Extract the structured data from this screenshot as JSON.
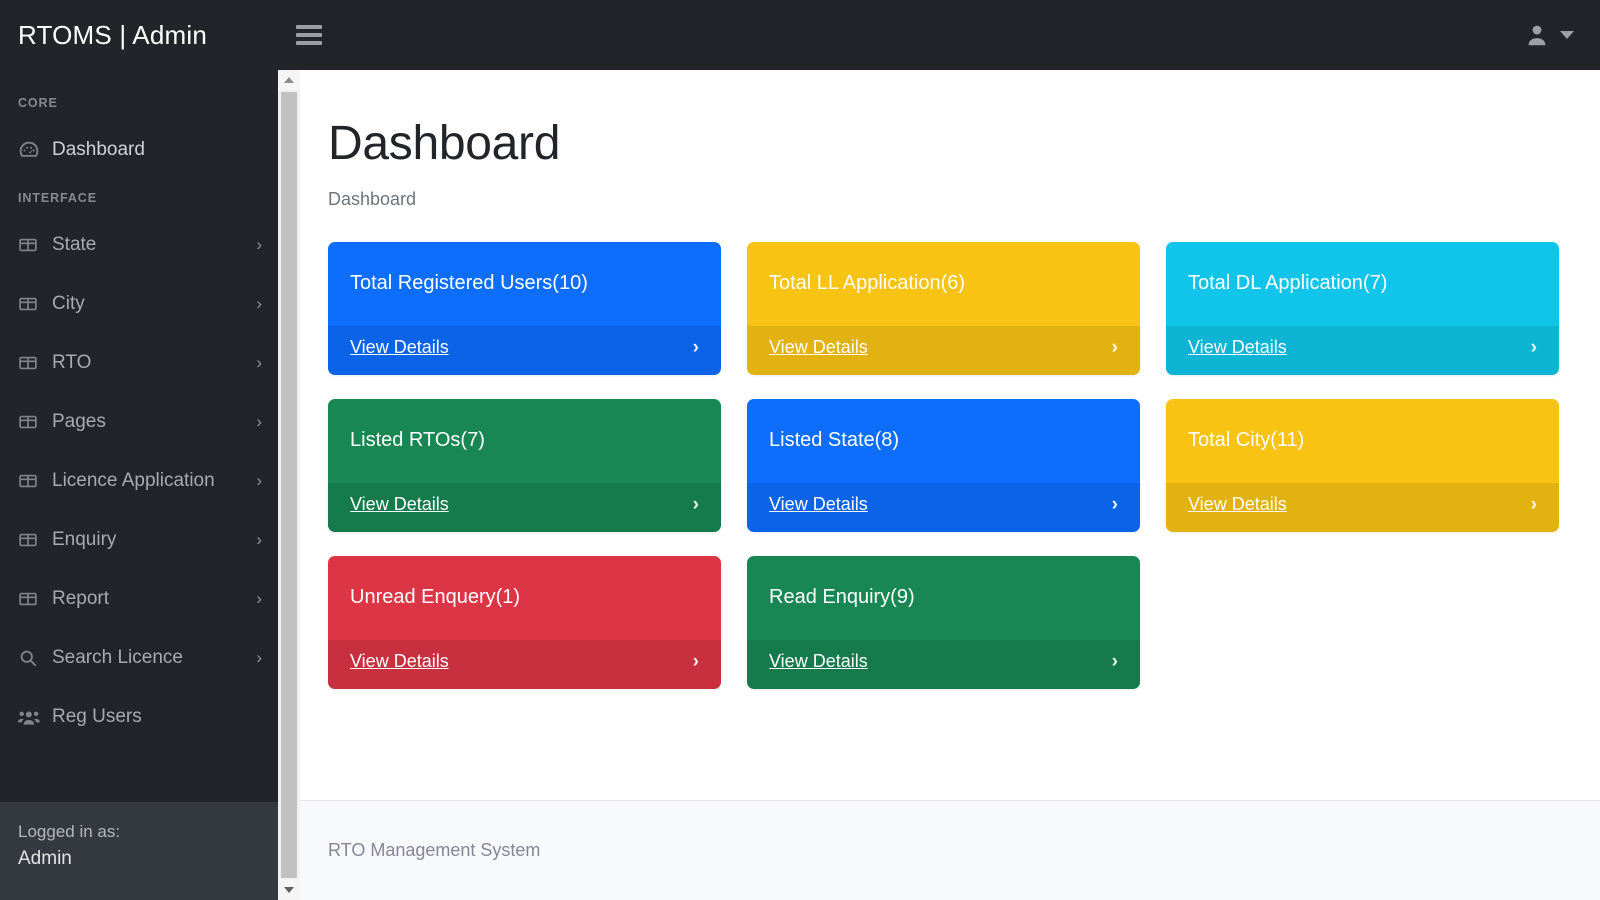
{
  "brand": {
    "title": "RTOMS | Admin"
  },
  "topbar": {
    "menu_toggle_icon": "hamburger-icon",
    "user_icon": "user-icon",
    "user_caret_icon": "caret-down-icon"
  },
  "sidebar": {
    "sections": [
      {
        "heading": "CORE",
        "items": [
          {
            "label": "Dashboard",
            "icon": "tachometer-icon",
            "chevron": "",
            "active": true
          }
        ]
      },
      {
        "heading": "INTERFACE",
        "items": [
          {
            "label": "State",
            "icon": "columns-icon",
            "chevron": "›"
          },
          {
            "label": "City",
            "icon": "columns-icon",
            "chevron": "›"
          },
          {
            "label": "RTO",
            "icon": "columns-icon",
            "chevron": "›"
          },
          {
            "label": "Pages",
            "icon": "columns-icon",
            "chevron": "›"
          },
          {
            "label": "Licence Application",
            "icon": "columns-icon",
            "chevron": "›"
          },
          {
            "label": "Enquiry",
            "icon": "columns-icon",
            "chevron": "›"
          },
          {
            "label": "Report",
            "icon": "columns-icon",
            "chevron": "›"
          },
          {
            "label": "Search Licence",
            "icon": "search-icon",
            "chevron": "›"
          },
          {
            "label": "Reg Users",
            "icon": "users-icon",
            "chevron": ""
          }
        ]
      }
    ],
    "footer": {
      "logged_in_label": "Logged in as:",
      "user_name": "Admin"
    }
  },
  "main": {
    "page_title": "Dashboard",
    "breadcrumb": "Dashboard",
    "footer_text": "RTO Management System",
    "cards": [
      {
        "title": "Total Registered Users(10)",
        "link": "View Details",
        "arrow": "›",
        "color": "#0d6efd",
        "count": 10
      },
      {
        "title": "Total LL Application(6)",
        "link": "View Details",
        "arrow": "›",
        "color": "#f8c313",
        "count": 6
      },
      {
        "title": "Total DL Application(7)",
        "link": "View Details",
        "arrow": "›",
        "color": "#10c5e9",
        "count": 7
      },
      {
        "title": "Listed RTOs(7)",
        "link": "View Details",
        "arrow": "›",
        "color": "#198754",
        "count": 7
      },
      {
        "title": "Listed State(8)",
        "link": "View Details",
        "arrow": "›",
        "color": "#0d6efd",
        "count": 8
      },
      {
        "title": "Total City(11)",
        "link": "View Details",
        "arrow": "›",
        "color": "#f8c313",
        "count": 11
      },
      {
        "title": "Unread Enquery(1)",
        "link": "View Details",
        "arrow": "›",
        "color": "#dc3545",
        "count": 1
      },
      {
        "title": "Read Enquiry(9)",
        "link": "View Details",
        "arrow": "›",
        "color": "#198754",
        "count": 9
      }
    ]
  },
  "scrollbar": {
    "up_icon": "scroll-up-arrow-icon",
    "down_icon": "scroll-down-arrow-icon"
  }
}
